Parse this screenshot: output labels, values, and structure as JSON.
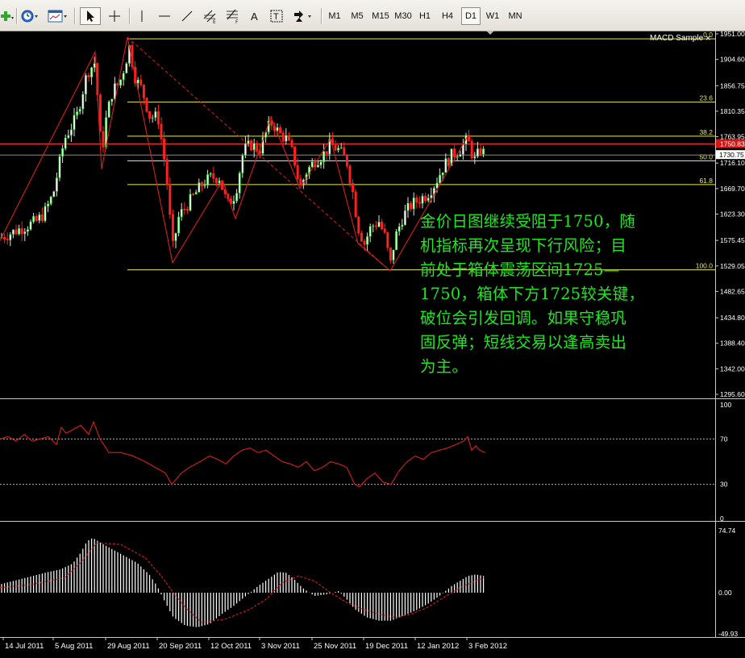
{
  "toolbar": {
    "timeframes": [
      "M1",
      "M5",
      "M15",
      "M30",
      "H1",
      "H4",
      "D1",
      "W1",
      "MN"
    ],
    "active_timeframe": "D1",
    "tools": [
      "new-order-icon",
      "clock-icon",
      "chart-window-icon",
      "cursor-icon",
      "crosshair-icon",
      "vertical-line-icon",
      "horizontal-line-icon",
      "trendline-icon",
      "equidistant-channel-icon",
      "fibonacci-icon",
      "text-icon",
      "text-label-icon",
      "arrows-icon"
    ]
  },
  "indicator_label": "MACD Sample",
  "indicator_close": "×",
  "commentary_lines": [
    "金价日图继续受阻于1750，随",
    "机指标再次呈现下行风险；目",
    "前处于箱体震荡区间1725—",
    "1750，箱体下方1725较关键，",
    "破位会引发回调。如果守稳巩",
    "固反弹；短线交易以逢高卖出",
    "为主。"
  ],
  "colors": {
    "background": "#000000",
    "candle_up": "#ffffff",
    "candle_down": "#ff2020",
    "candle_body_outline": "#00b200",
    "fib": "#e8e85a",
    "trend": "#d81e1e",
    "rsi_line": "#d81e1e",
    "histogram": "#ffffff",
    "signal": "#d81e1e",
    "text_green": "#1ee81e",
    "current_price_bg": "#d01818"
  },
  "chart_data": [
    {
      "type": "candlestick",
      "title": "",
      "price_axis_labels": [
        "1951.00",
        "1904.60",
        "1856.75",
        "1810.35",
        "1763.95",
        "1716.10",
        "1669.70",
        "1623.30",
        "1575.45",
        "1529.05",
        "1482.65",
        "1434.80",
        "1388.40",
        "1342.00",
        "1295.60"
      ],
      "ylim": [
        1295.6,
        1951.0
      ],
      "current_price": "1730.75",
      "current_price_value": 1730.75,
      "red_line_price_label": "1750.83",
      "red_line_price": 1750.83,
      "fib_levels": [
        {
          "label": "0.0",
          "price": 1942.0
        },
        {
          "label": "23.6",
          "price": 1827.0
        },
        {
          "label": "38.2",
          "price": 1765.0
        },
        {
          "label": "50.0",
          "price": 1720.0
        },
        {
          "label": "61.8",
          "price": 1677.0
        },
        {
          "label": "100.0",
          "price": 1522.0
        }
      ],
      "date_labels": [
        "14 Jul 2011",
        "5 Aug 2011",
        "29 Aug 2011",
        "20 Sep 2011",
        "12 Oct 2011",
        "3 Nov 2011",
        "25 Nov 2011",
        "19 Dec 2011",
        "12 Jan 2012",
        "3 Feb 2012"
      ],
      "close_path": [
        [
          0,
          1580
        ],
        [
          15,
          1590
        ],
        [
          30,
          1600
        ],
        [
          45,
          1610
        ],
        [
          55,
          1625
        ],
        [
          66,
          1660
        ],
        [
          80,
          1760
        ],
        [
          95,
          1800
        ],
        [
          108,
          1880
        ],
        [
          118,
          1900
        ],
        [
          126,
          1730
        ],
        [
          132,
          1800
        ],
        [
          140,
          1850
        ],
        [
          148,
          1860
        ],
        [
          156,
          1900
        ],
        [
          160,
          1930
        ],
        [
          168,
          1870
        ],
        [
          176,
          1850
        ],
        [
          186,
          1800
        ],
        [
          196,
          1800
        ],
        [
          206,
          1700
        ],
        [
          214,
          1560
        ],
        [
          222,
          1620
        ],
        [
          232,
          1640
        ],
        [
          242,
          1660
        ],
        [
          252,
          1680
        ],
        [
          262,
          1690
        ],
        [
          272,
          1690
        ],
        [
          282,
          1640
        ],
        [
          292,
          1660
        ],
        [
          302,
          1740
        ],
        [
          312,
          1750
        ],
        [
          322,
          1740
        ],
        [
          332,
          1780
        ],
        [
          338,
          1790
        ],
        [
          346,
          1770
        ],
        [
          355,
          1760
        ],
        [
          364,
          1730
        ],
        [
          372,
          1670
        ],
        [
          380,
          1700
        ],
        [
          390,
          1720
        ],
        [
          400,
          1730
        ],
        [
          410,
          1750
        ],
        [
          420,
          1740
        ],
        [
          430,
          1720
        ],
        [
          438,
          1660
        ],
        [
          444,
          1600
        ],
        [
          452,
          1570
        ],
        [
          460,
          1600
        ],
        [
          470,
          1610
        ],
        [
          478,
          1580
        ],
        [
          484,
          1530
        ],
        [
          490,
          1580
        ],
        [
          500,
          1620
        ],
        [
          510,
          1640
        ],
        [
          520,
          1650
        ],
        [
          530,
          1660
        ],
        [
          540,
          1680
        ],
        [
          550,
          1710
        ],
        [
          560,
          1730
        ],
        [
          570,
          1740
        ],
        [
          580,
          1760
        ],
        [
          588,
          1720
        ],
        [
          596,
          1740
        ],
        [
          603,
          1730
        ]
      ]
    },
    {
      "type": "line",
      "title": "",
      "series_name": "",
      "ylim": [
        0,
        100
      ],
      "tick_labels": [
        "100",
        "70",
        "30",
        "0"
      ],
      "levels": [
        70,
        30
      ],
      "x": [
        0,
        10,
        20,
        30,
        40,
        50,
        60,
        70,
        76,
        82,
        90,
        100,
        110,
        116,
        124,
        135,
        150,
        165,
        180,
        195,
        205,
        213,
        225,
        235,
        248,
        260,
        270,
        280,
        290,
        300,
        310,
        320,
        330,
        340,
        350,
        360,
        370,
        380,
        390,
        400,
        410,
        420,
        430,
        440,
        446,
        455,
        465,
        475,
        485,
        495,
        505,
        515,
        525,
        535,
        545,
        555,
        565,
        575,
        580,
        585,
        590,
        595,
        602
      ],
      "y": [
        70,
        72,
        68,
        74,
        68,
        70,
        72,
        65,
        80,
        75,
        78,
        82,
        74,
        85,
        70,
        58,
        58,
        55,
        50,
        44,
        40,
        30,
        40,
        45,
        50,
        55,
        52,
        48,
        55,
        60,
        62,
        58,
        60,
        55,
        50,
        48,
        45,
        50,
        42,
        45,
        50,
        48,
        45,
        30,
        28,
        35,
        40,
        32,
        30,
        42,
        50,
        55,
        52,
        58,
        60,
        62,
        65,
        68,
        72,
        60,
        64,
        60,
        58
      ]
    },
    {
      "type": "bar",
      "title": "",
      "ylim": [
        -49.93,
        74.74
      ],
      "tick_labels": [
        "74.74",
        "0.00",
        "-49.93"
      ],
      "x": [
        0,
        20,
        40,
        60,
        75,
        90,
        100,
        108,
        115,
        125,
        140,
        155,
        170,
        185,
        195,
        205,
        215,
        230,
        245,
        260,
        275,
        290,
        305,
        320,
        335,
        345,
        355,
        365,
        375,
        390,
        405,
        420,
        430,
        440,
        455,
        470,
        485,
        500,
        515,
        530,
        545,
        560,
        570,
        580,
        590,
        600
      ],
      "values": [
        10,
        15,
        20,
        25,
        28,
        35,
        48,
        62,
        66,
        60,
        52,
        44,
        36,
        22,
        8,
        -12,
        -30,
        -40,
        -42,
        -38,
        -26,
        -16,
        -4,
        8,
        18,
        25,
        24,
        16,
        6,
        -4,
        -2,
        2,
        -8,
        -20,
        -30,
        -34,
        -34,
        -28,
        -22,
        -14,
        -4,
        8,
        14,
        20,
        22,
        20
      ],
      "signal_x": [
        0,
        40,
        80,
        100,
        120,
        150,
        180,
        200,
        215,
        230,
        250,
        280,
        310,
        330,
        350,
        370,
        390,
        410,
        430,
        450,
        470,
        490,
        510,
        530,
        550,
        570,
        590,
        600
      ],
      "signal_values": [
        6,
        10,
        18,
        36,
        60,
        58,
        42,
        20,
        0,
        -18,
        -36,
        -32,
        -20,
        -8,
        12,
        20,
        14,
        0,
        -12,
        -20,
        -26,
        -30,
        -26,
        -18,
        -6,
        6,
        14,
        18
      ]
    }
  ]
}
